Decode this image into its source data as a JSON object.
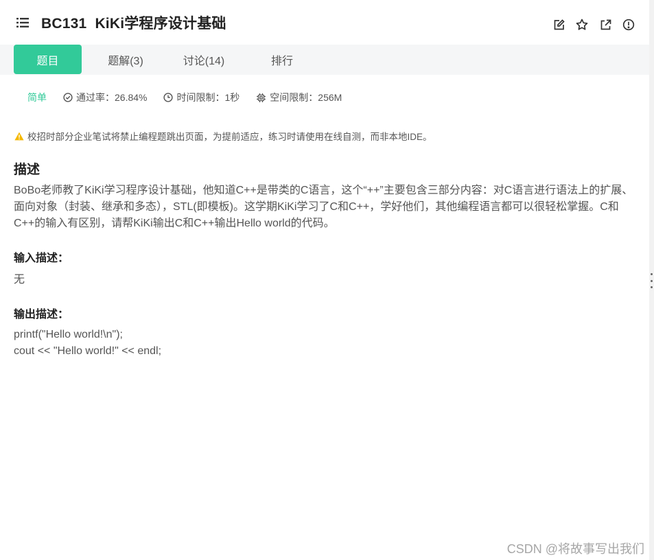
{
  "header": {
    "title": "BC131  KiKi学程序设计基础",
    "actions": [
      "edit-icon",
      "star-icon",
      "external-link-icon",
      "report-icon"
    ]
  },
  "tabs": [
    {
      "label": "题目",
      "active": true
    },
    {
      "label": "题解(3)",
      "active": false
    },
    {
      "label": "讨论(14)",
      "active": false
    },
    {
      "label": "排行",
      "active": false
    }
  ],
  "meta": {
    "difficulty": "简单",
    "pass_rate": "通过率：26.84%",
    "time_limit": "时间限制：1秒",
    "memory_limit": "空间限制：256M"
  },
  "notice": "校招时部分企业笔试将禁止编程题跳出页面，为提前适应，练习时请使用在线自测，而非本地IDE。",
  "description": {
    "title": "描述",
    "text": "BoBo老师教了KiKi学习程序设计基础，他知道C++是带类的C语言，这个“++”主要包含三部分内容：对C语言进行语法上的扩展、面向对象（封装、继承和多态），STL(即模板)。这学期KiKi学习了C和C++，学好他们，其他编程语言都可以很轻松掌握。C和C++的输入有区别，请帮KiKi输出C和C++输出Hello world的代码。"
  },
  "input": {
    "title": "输入描述：",
    "text": "无"
  },
  "output": {
    "title": "输出描述：",
    "lines": [
      "printf(\"Hello world!\\n\");",
      "cout << \"Hello world!\" << endl;"
    ]
  },
  "watermark": "CSDN @将故事写出我们",
  "colors": {
    "accent": "#32ca99",
    "warning": "#f5b800",
    "text": "#555555",
    "heading": "#222222"
  }
}
